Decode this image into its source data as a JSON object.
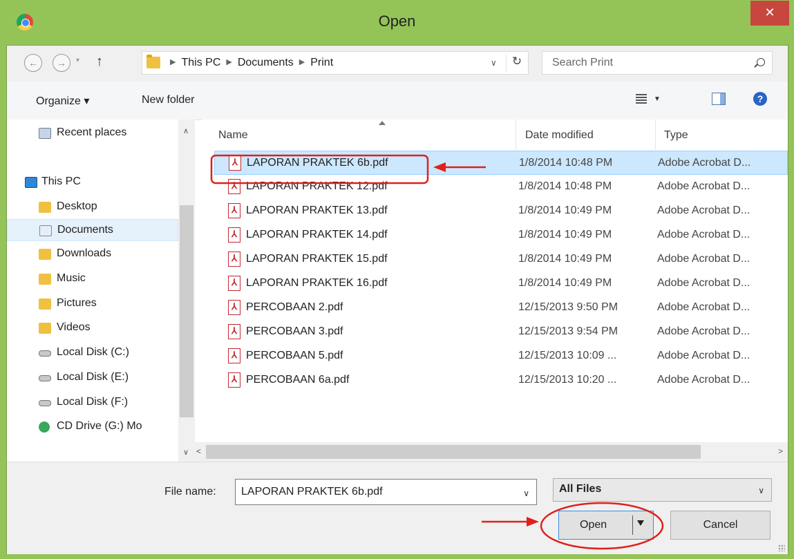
{
  "window": {
    "title": "Open",
    "close_glyph": "✕",
    "app_icon": "chrome-icon"
  },
  "nav": {
    "back_glyph": "←",
    "forward_glyph": "→",
    "dropdown_glyph": "▾",
    "up_glyph": "↑",
    "breadcrumb": [
      "This PC",
      "Documents",
      "Print"
    ],
    "crumb_sep": "▶",
    "address_dropdown_glyph": "∨",
    "refresh_glyph": "↻",
    "search_placeholder": "Search Print"
  },
  "toolbar": {
    "organize_label": "Organize ▾",
    "new_folder_label": "New folder",
    "view_dropdown_glyph": "▼",
    "help_glyph": "?"
  },
  "sidebar": {
    "scroll_up": "∧",
    "scroll_down": "∨",
    "items": [
      {
        "label": "Recent places",
        "icon": "recent-places-icon"
      },
      {
        "label": "This PC",
        "icon": "computer-icon"
      },
      {
        "label": "Desktop",
        "icon": "folder-icon"
      },
      {
        "label": "Documents",
        "icon": "documents-icon",
        "selected": true
      },
      {
        "label": "Downloads",
        "icon": "folder-icon"
      },
      {
        "label": "Music",
        "icon": "folder-icon"
      },
      {
        "label": "Pictures",
        "icon": "folder-icon"
      },
      {
        "label": "Videos",
        "icon": "folder-icon"
      },
      {
        "label": "Local Disk (C:)",
        "icon": "disk-icon"
      },
      {
        "label": "Local Disk (E:)",
        "icon": "disk-icon"
      },
      {
        "label": "Local Disk (F:)",
        "icon": "disk-icon"
      },
      {
        "label": "CD Drive (G:) Mo",
        "icon": "cd-drive-icon"
      }
    ]
  },
  "file_list": {
    "columns": [
      "Name",
      "Date modified",
      "Type"
    ],
    "file_icon_glyph": "⅄",
    "rows": [
      {
        "name": "LAPORAN PRAKTEK 6b.pdf",
        "date": "1/8/2014 10:48 PM",
        "type": "Adobe Acrobat D...",
        "selected": true
      },
      {
        "name": "LAPORAN PRAKTEK 12.pdf",
        "date": "1/8/2014 10:48 PM",
        "type": "Adobe Acrobat D..."
      },
      {
        "name": "LAPORAN PRAKTEK 13.pdf",
        "date": "1/8/2014 10:49 PM",
        "type": "Adobe Acrobat D..."
      },
      {
        "name": "LAPORAN PRAKTEK 14.pdf",
        "date": "1/8/2014 10:49 PM",
        "type": "Adobe Acrobat D..."
      },
      {
        "name": "LAPORAN PRAKTEK 15.pdf",
        "date": "1/8/2014 10:49 PM",
        "type": "Adobe Acrobat D..."
      },
      {
        "name": "LAPORAN PRAKTEK 16.pdf",
        "date": "1/8/2014 10:49 PM",
        "type": "Adobe Acrobat D..."
      },
      {
        "name": "PERCOBAAN 2.pdf",
        "date": "12/15/2013 9:50 PM",
        "type": "Adobe Acrobat D..."
      },
      {
        "name": "PERCOBAAN 3.pdf",
        "date": "12/15/2013 9:54 PM",
        "type": "Adobe Acrobat D..."
      },
      {
        "name": "PERCOBAAN 5.pdf",
        "date": "12/15/2013 10:09 ...",
        "type": "Adobe Acrobat D..."
      },
      {
        "name": "PERCOBAAN 6a.pdf",
        "date": "12/15/2013 10:20 ...",
        "type": "Adobe Acrobat D..."
      }
    ],
    "hscroll_left": "<",
    "hscroll_right": ">"
  },
  "footer": {
    "file_name_label": "File name:",
    "file_name_value": "LAPORAN PRAKTEK 6b.pdf",
    "file_name_dropdown_glyph": "∨",
    "filter_value": "All Files",
    "filter_dropdown_glyph": "∨",
    "open_label": "Open",
    "cancel_label": "Cancel"
  },
  "colors": {
    "window_frame": "#94c458",
    "close_button": "#c7463e",
    "selection": "#cce8ff",
    "annotation_red": "#e0201a"
  }
}
